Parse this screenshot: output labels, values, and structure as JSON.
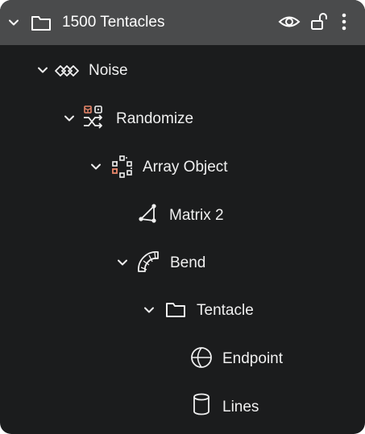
{
  "header": {
    "title": "1500 Tentacles",
    "icon": "folder-icon",
    "actions": [
      "eye-icon",
      "unlock-icon",
      "more-vert-icon"
    ]
  },
  "tree": [
    {
      "label": "Noise",
      "icon": "noise-icon",
      "expanded": true
    },
    {
      "label": "Randomize",
      "icon": "randomize-icon",
      "expanded": true
    },
    {
      "label": "Array Object",
      "icon": "array-object-icon",
      "expanded": true
    },
    {
      "label": "Matrix 2",
      "icon": "matrix-icon",
      "expanded": false
    },
    {
      "label": "Bend",
      "icon": "bend-icon",
      "expanded": true
    },
    {
      "label": "Tentacle",
      "icon": "folder-icon",
      "expanded": true
    },
    {
      "label": "Endpoint",
      "icon": "sphere-icon",
      "expanded": false
    },
    {
      "label": "Lines",
      "icon": "cylinder-icon",
      "expanded": false
    }
  ],
  "colors": {
    "background": "#1b1c1d",
    "header": "#4a4b4c",
    "text": "#f0f0f0",
    "accent": "#e8866a"
  }
}
